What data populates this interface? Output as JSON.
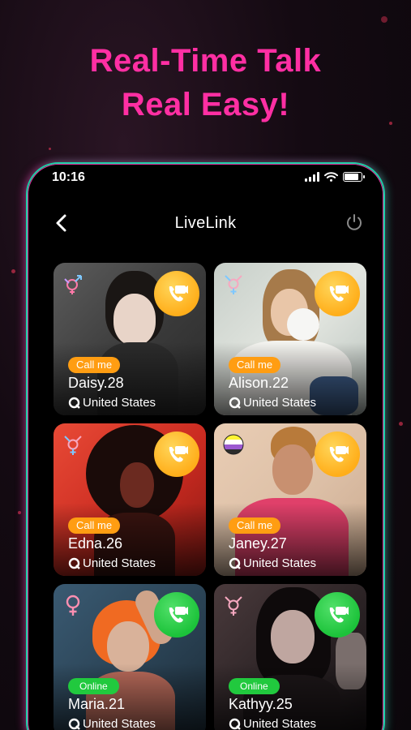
{
  "promo": {
    "line1": "Real-Time Talk",
    "line2": "Real Easy!"
  },
  "status_bar": {
    "time": "10:16"
  },
  "nav": {
    "title": "LiveLink"
  },
  "profiles": [
    {
      "name_age": "Daisy.28",
      "location": "United States",
      "badge": "Call me",
      "status": "call",
      "gender_icon": "genderfluid-icon"
    },
    {
      "name_age": "Alison.22",
      "location": "United States",
      "badge": "Call me",
      "status": "call",
      "gender_icon": "transgender-icon"
    },
    {
      "name_age": "Edna.26",
      "location": "United States",
      "badge": "Call me",
      "status": "call",
      "gender_icon": "transgender-icon"
    },
    {
      "name_age": "Janey.27",
      "location": "United States",
      "badge": "Call me",
      "status": "call",
      "gender_icon": "nonbinary-flag-icon"
    },
    {
      "name_age": "Maria.21",
      "location": "United States",
      "badge": "Online",
      "status": "online",
      "gender_icon": "female-icon"
    },
    {
      "name_age": "Kathyy.25",
      "location": "United States",
      "badge": "Online",
      "status": "online",
      "gender_icon": "transgender-icon"
    }
  ],
  "colors": {
    "headline": "#ff2fa3",
    "call_orange": "#ffae1a",
    "online_green": "#21c93e",
    "frame_teal": "#1bd0a6",
    "frame_pink": "#e0309b"
  }
}
